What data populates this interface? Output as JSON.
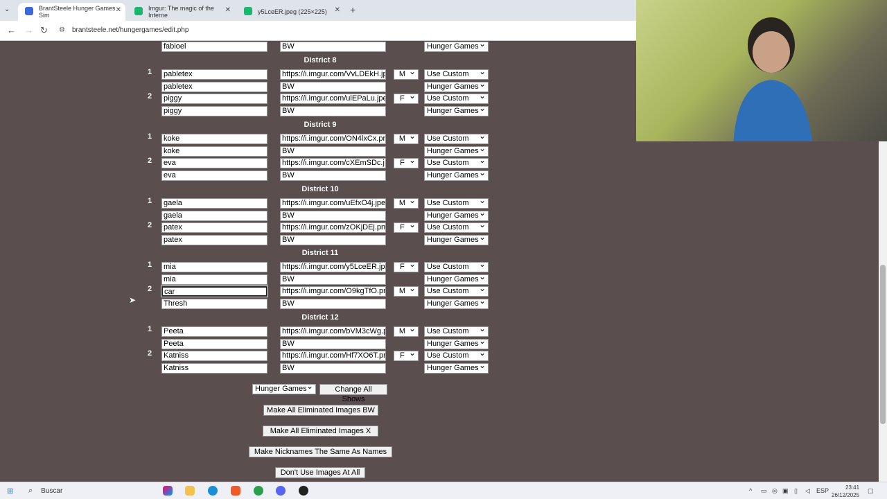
{
  "browser": {
    "tabs": [
      {
        "title": "BrantSteele Hunger Games Sim",
        "color": "#3a6bd6"
      },
      {
        "title": "Imgur: The magic of the Interne",
        "color": "#1bb76e"
      },
      {
        "title": "y5LceER.jpeg (225×225)",
        "color": "#1bb76e"
      }
    ],
    "url": "brantsteele.net/hungergames/edit.php"
  },
  "top_partial": {
    "name": "fabioel",
    "image": "BW",
    "show": "Hunger Games"
  },
  "districts": [
    {
      "title": "District 8",
      "tributes": [
        {
          "num": "1",
          "name": "pabletex",
          "image": "https://i.imgur.com/VvLDEkH.jp",
          "gender": "M",
          "custom": "Use Custom",
          "nick": "pabletex",
          "elim": "BW",
          "show": "Hunger Games"
        },
        {
          "num": "2",
          "name": "piggy",
          "image": "https://i.imgur.com/ulEPaLu.jpe",
          "gender": "F",
          "custom": "Use Custom",
          "nick": "piggy",
          "elim": "BW",
          "show": "Hunger Games"
        }
      ]
    },
    {
      "title": "District 9",
      "tributes": [
        {
          "num": "1",
          "name": "koke",
          "image": "https://i.imgur.com/ON4lxCx.pr",
          "gender": "M",
          "custom": "Use Custom",
          "nick": "koke",
          "elim": "BW",
          "show": "Hunger Games"
        },
        {
          "num": "2",
          "name": "eva",
          "image": "https://i.imgur.com/cXEmSDc.j",
          "gender": "F",
          "custom": "Use Custom",
          "nick": "eva",
          "elim": "BW",
          "show": "Hunger Games"
        }
      ]
    },
    {
      "title": "District 10",
      "tributes": [
        {
          "num": "1",
          "name": "gaela",
          "image": "https://i.imgur.com/uEfxO4j.jpe",
          "gender": "M",
          "custom": "Use Custom",
          "nick": "gaela",
          "elim": "BW",
          "show": "Hunger Games"
        },
        {
          "num": "2",
          "name": "patex",
          "image": "https://i.imgur.com/zOKjDEj.pn",
          "gender": "F",
          "custom": "Use Custom",
          "nick": "patex",
          "elim": "BW",
          "show": "Hunger Games"
        }
      ]
    },
    {
      "title": "District 11",
      "tributes": [
        {
          "num": "1",
          "name": "mia",
          "image": "https://i.imgur.com/y5LceER.jp",
          "gender": "F",
          "custom": "Use Custom",
          "nick": "mia",
          "elim": "BW",
          "show": "Hunger Games"
        },
        {
          "num": "2",
          "name": "car",
          "image": "https://i.imgur.com/O9kgTfO.pr",
          "gender": "M",
          "custom": "Use Custom",
          "nick": "Thresh",
          "elim": "BW",
          "show": "Hunger Games"
        }
      ]
    },
    {
      "title": "District 12",
      "tributes": [
        {
          "num": "1",
          "name": "Peeta",
          "image": "https://i.imgur.com/bVM3cWg.p",
          "gender": "M",
          "custom": "Use Custom",
          "nick": "Peeta",
          "elim": "BW",
          "show": "Hunger Games"
        },
        {
          "num": "2",
          "name": "Katniss",
          "image": "https://i.imgur.com/Hf7XO6T.pr",
          "gender": "F",
          "custom": "Use Custom",
          "nick": "Katniss",
          "elim": "BW",
          "show": "Hunger Games"
        }
      ]
    }
  ],
  "controls": {
    "show_select": "Hunger Games",
    "change_all": "Change All Shows",
    "make_bw": "Make All Eliminated Images BW",
    "make_x": "Make All Eliminated Images X",
    "nick_same": "Make Nicknames The Same As Names",
    "no_images": "Don't Use Images At All"
  },
  "taskbar": {
    "search": "Buscar",
    "lang": "ESP",
    "time": "23:41",
    "date": "26/12/2025"
  }
}
